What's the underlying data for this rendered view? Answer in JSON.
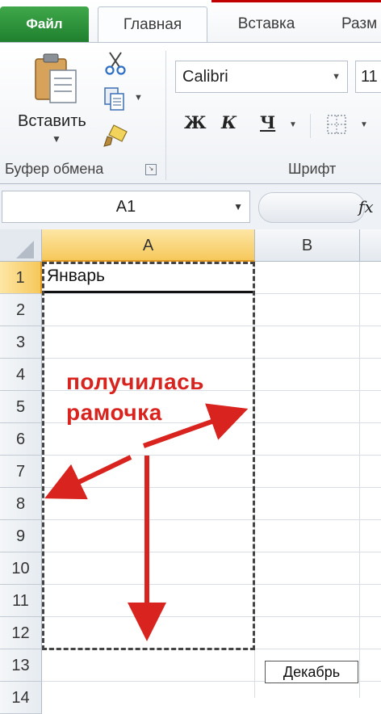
{
  "ribbon": {
    "tabs": {
      "file": "Файл",
      "home": "Главная",
      "insert": "Вставка",
      "layout": "Разм"
    },
    "clipboard": {
      "paste_label": "Вставить",
      "group_label": "Буфер обмена"
    },
    "font": {
      "font_name": "Calibri",
      "font_size": "11",
      "bold": "Ж",
      "italic": "К",
      "underline": "Ч",
      "group_label": "Шрифт"
    }
  },
  "formula_bar": {
    "name_box": "A1",
    "fx": "fx"
  },
  "sheet": {
    "columns": [
      "A",
      "B"
    ],
    "rows": [
      "1",
      "2",
      "3",
      "4",
      "5",
      "6",
      "7",
      "8",
      "9",
      "10",
      "11",
      "12",
      "13",
      "14"
    ],
    "cells": {
      "A1": "Январь",
      "B13": "Декабрь"
    },
    "selected_cell": "A1"
  },
  "annotation": {
    "line1": "получилась",
    "line2": "рамочка",
    "color": "#d8231e"
  },
  "colors": {
    "file_tab": "#2e8b3a",
    "selected_header": "#f6c85b",
    "top_accent": "#c00000"
  }
}
